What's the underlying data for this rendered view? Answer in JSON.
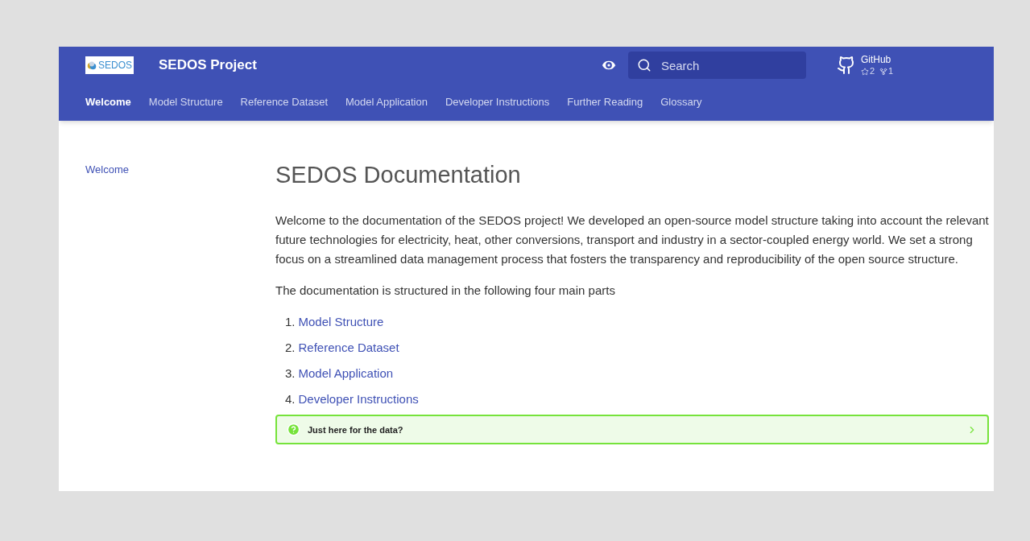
{
  "header": {
    "logo_text": "SEDOS",
    "title": "SEDOS Project",
    "search": {
      "placeholder": "Search"
    },
    "repo": {
      "name": "GitHub",
      "stars": "2",
      "forks": "1"
    }
  },
  "tabs": [
    {
      "label": "Welcome",
      "selected": true
    },
    {
      "label": "Model Structure",
      "selected": false
    },
    {
      "label": "Reference Dataset",
      "selected": false
    },
    {
      "label": "Model Application",
      "selected": false
    },
    {
      "label": "Developer Instructions",
      "selected": false
    },
    {
      "label": "Further Reading",
      "selected": false
    },
    {
      "label": "Glossary",
      "selected": false
    }
  ],
  "sidebar": {
    "items": [
      {
        "label": "Welcome"
      }
    ]
  },
  "content": {
    "heading": "SEDOS Documentation",
    "paragraphs": [
      "Welcome to the documentation of the SEDOS project! We developed an open-source model structure taking into account the relevant future technologies for electricity, heat, other conversions, transport and industry in a sector-coupled energy world. We set a strong focus on a streamlined data management process that fosters the transparency and reproducibility of the open source structure.",
      "The documentation is structured in the following four main parts"
    ],
    "list": [
      {
        "number": "1.",
        "label": "Model Structure"
      },
      {
        "number": "2.",
        "label": "Reference Dataset"
      },
      {
        "number": "3.",
        "label": "Model Application"
      },
      {
        "number": "4.",
        "label": "Developer Instructions"
      }
    ],
    "callout": {
      "title": "Just here for the data?",
      "expanded": false
    }
  }
}
